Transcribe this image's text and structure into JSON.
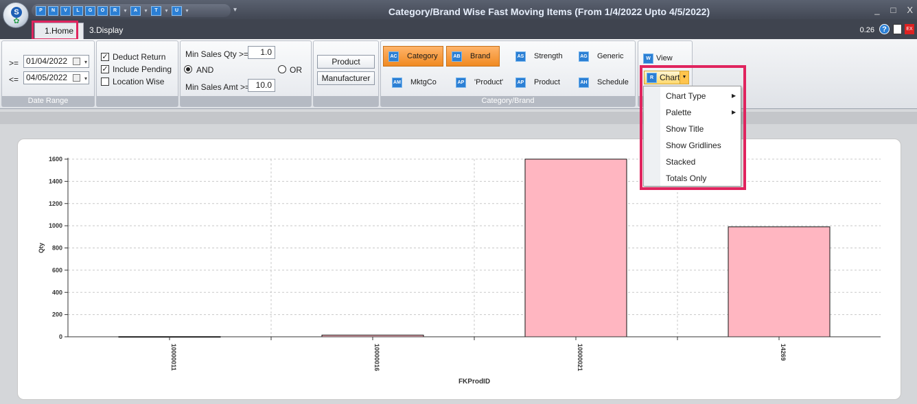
{
  "window": {
    "title": "Category/Brand Wise Fast Moving Items (From 1/4/2022 Upto 4/5/2022)",
    "controls": [
      "_",
      "□",
      "X"
    ]
  },
  "quick_access": [
    "P",
    "N",
    "V",
    "L",
    "G",
    "O",
    "R",
    "A",
    "T",
    "U"
  ],
  "tabs": [
    {
      "label": "1.Home",
      "active": true
    },
    {
      "label": "3.Display",
      "active": false
    }
  ],
  "top_right": {
    "version": "0.26"
  },
  "date_range": {
    "from_prefix": ">=",
    "from": "01/04/2022",
    "to_prefix": "<=",
    "to": "04/05/2022",
    "group_label": "Date Range"
  },
  "options": {
    "deduct_return": {
      "label": "Deduct Return",
      "checked": true
    },
    "include_pending": {
      "label": "Include Pending",
      "checked": true
    },
    "location_wise": {
      "label": "Location Wise",
      "checked": false
    }
  },
  "filters": {
    "min_qty_label": "Min Sales Qty >=",
    "min_qty": "1.0",
    "and_label": "AND",
    "or_label": "OR",
    "selected": "AND",
    "min_amt_label": "Min Sales Amt >=",
    "min_amt": "10.0"
  },
  "group_by": {
    "product": "Product",
    "manufacturer": "Manufacturer"
  },
  "category_brand": {
    "group_label": "Category/Brand",
    "buttons": [
      {
        "label": "Category",
        "icon": "category-icon",
        "selected": true
      },
      {
        "label": "Brand",
        "icon": "brand-icon",
        "selected": true
      },
      {
        "label": "Strength",
        "icon": "strength-icon",
        "selected": false
      },
      {
        "label": "Generic",
        "icon": "generic-icon",
        "selected": false
      },
      {
        "label": "MktgCo",
        "icon": "mktgco-icon",
        "selected": false
      },
      {
        "label": "'Product'",
        "icon": "product-quoted-icon",
        "selected": false
      },
      {
        "label": "Product",
        "icon": "product-icon",
        "selected": false
      },
      {
        "label": "Schedule",
        "icon": "schedule-icon",
        "selected": false
      }
    ]
  },
  "view": {
    "view_label": "View",
    "chart_label": "Chart"
  },
  "chart_menu": {
    "items": [
      {
        "label": "Chart Type",
        "submenu": true
      },
      {
        "label": "Palette",
        "submenu": true
      },
      {
        "label": "Show Title",
        "submenu": false
      },
      {
        "label": "Show Gridlines",
        "submenu": false
      },
      {
        "label": "Stacked",
        "submenu": false
      },
      {
        "label": "Totals Only",
        "submenu": false
      }
    ]
  },
  "chart_data": {
    "type": "bar",
    "categories": [
      "10000011",
      "10000016",
      "10000021",
      "14269"
    ],
    "values": [
      2,
      15,
      1600,
      990
    ],
    "xlabel": "FKProdID",
    "ylabel": "Qty",
    "ylim": [
      0,
      1600
    ],
    "yticks": [
      0,
      200,
      400,
      600,
      800,
      1000,
      1200,
      1400,
      1600
    ],
    "bar_color": "#ffb6c1",
    "grid": true
  }
}
